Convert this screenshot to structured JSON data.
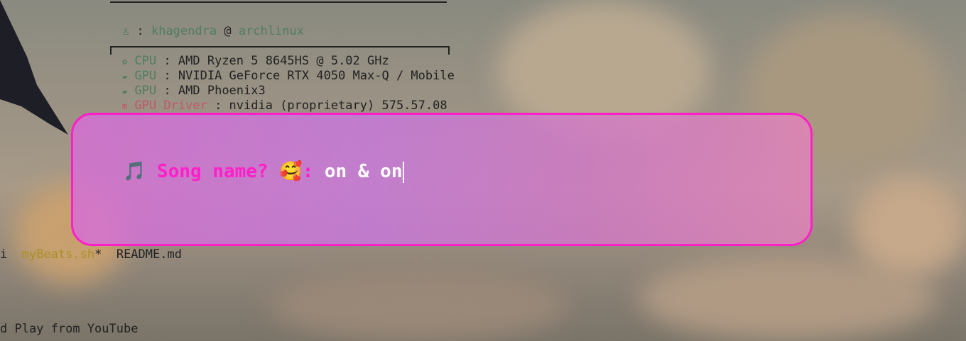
{
  "terminal": {
    "user_line": {
      "user": "khagendra",
      "separator": " : ",
      "at": " @ ",
      "host": "archlinux"
    },
    "specs": [
      {
        "icon": "cpu-icon",
        "key": "CPU",
        "value": " : AMD Ryzen 5 8645HS @ 5.02 GHz"
      },
      {
        "icon": "gpu-icon",
        "key": "GPU",
        "value": " : NVIDIA GeForce RTX 4050 Max-Q / Mobile"
      },
      {
        "icon": "gpu-icon",
        "key": "GPU",
        "value": " : AMD Phoenix3"
      },
      {
        "icon": "driver-icon",
        "key": "GPU Driver",
        "value": " : nvidia (proprietary) 575.57.08"
      }
    ],
    "file_list": {
      "partial": "i",
      "file1": "myBeats.sh",
      "file1_marker": "*",
      "file2": "README.md"
    },
    "bottom_line": "d Play from YouTube"
  },
  "popup": {
    "music_icon": "🎵",
    "prompt_label": "Song name? ",
    "emoji": "🥰",
    "colon": ": ",
    "input_value": "on & on"
  },
  "colors": {
    "accent": "#ff1fc9",
    "popup_fill": "#d070d0",
    "user_green": "#4f7d5f",
    "driver_pink": "#c0566a",
    "file_yellow": "#a89020"
  }
}
